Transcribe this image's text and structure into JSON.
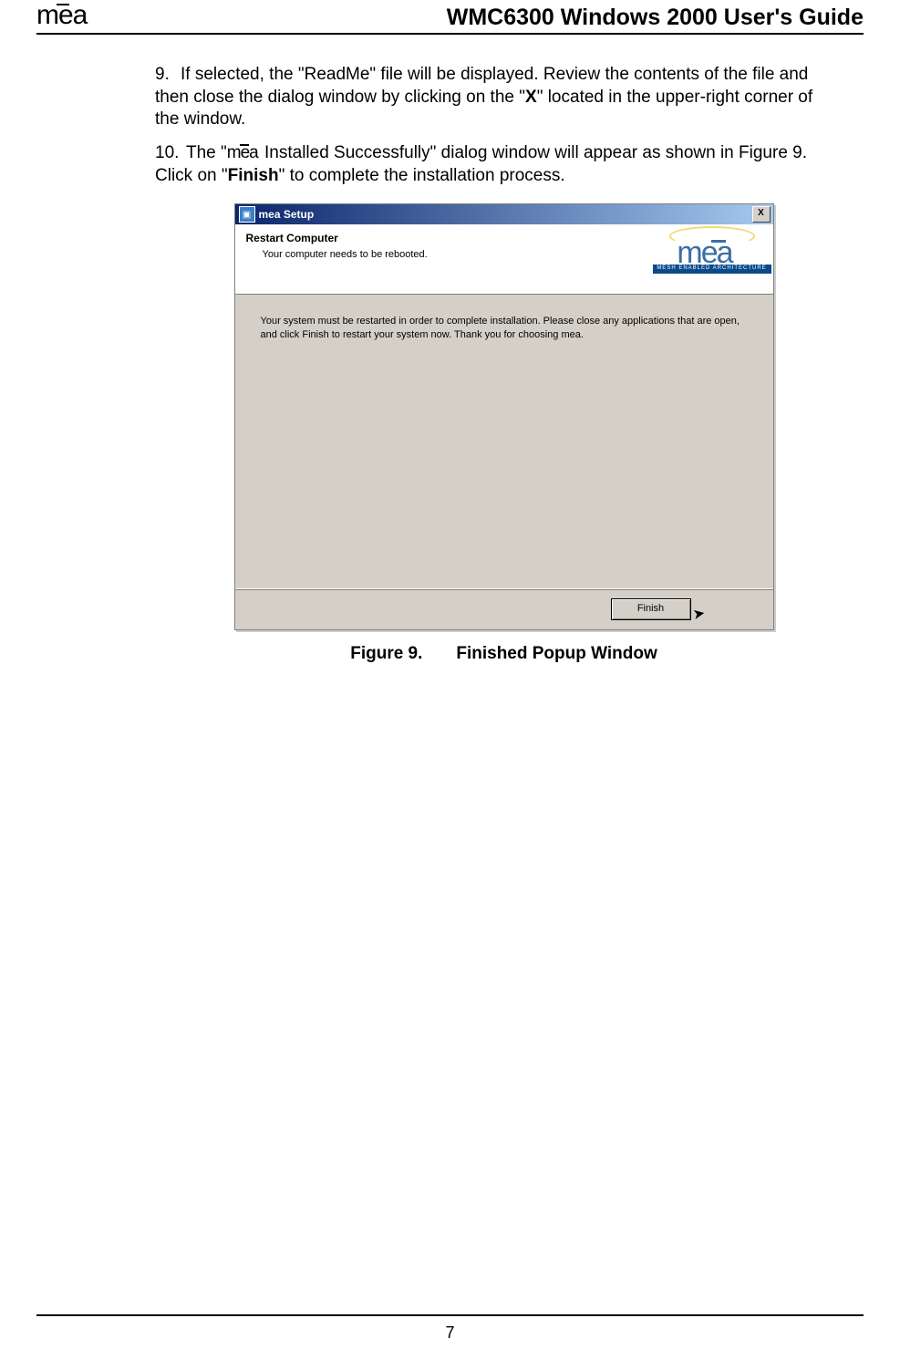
{
  "header": {
    "logo_text": "mea",
    "doc_title": "WMC6300 Windows 2000 User's Guide"
  },
  "list": {
    "item9_num": "9.",
    "item9_a": "If selected, the \"ReadMe\" file will be displayed.  Review the contents of the file and then close the dialog window by clicking on the \"",
    "item9_bold_x": "X",
    "item9_b": "\" located in the upper-right corner of the window.",
    "item10_num": "10.",
    "item10_a": "The \"",
    "item10_logo": "mea",
    "item10_b": " Installed Successfully\" dialog window will appear as shown in Figure 9.  Click on \"",
    "item10_bold_finish": "Finish",
    "item10_c": "\" to complete the installation process."
  },
  "dialog": {
    "title": "mea Setup",
    "close_x": "X",
    "banner_title": "Restart Computer",
    "banner_sub": "Your computer needs to be rebooted.",
    "logo_text": "mea",
    "logo_tag": "MESH ENABLED ARCHITECTURE",
    "body_text": "Your system must be restarted in order to complete installation.  Please close any applications that are open, and click Finish to restart your system now.  Thank you for choosing mea.",
    "finish_label": "Finish"
  },
  "caption": {
    "fig": "Figure 9.",
    "text": "Finished Popup Window"
  },
  "footer": {
    "page_num": "7"
  }
}
